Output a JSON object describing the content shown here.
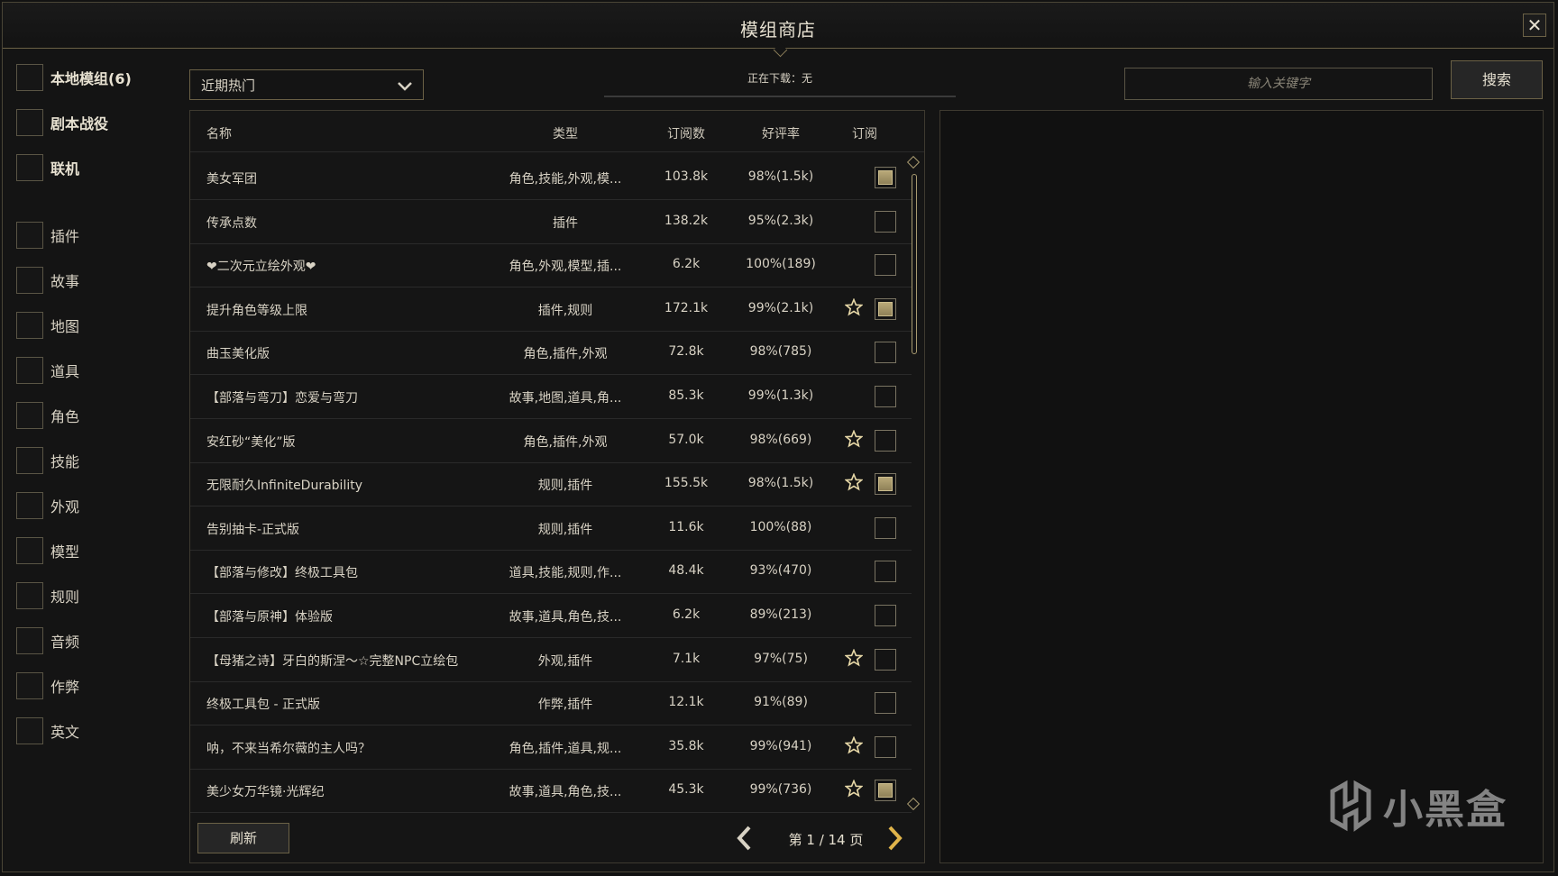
{
  "window": {
    "title": "模组商店",
    "close_glyph": "✕"
  },
  "sidebar": {
    "items": [
      {
        "label": "本地模组(6)",
        "bold": true
      },
      {
        "label": "剧本战役",
        "bold": true
      },
      {
        "label": "联机",
        "bold": true
      },
      {
        "label": "插件",
        "bold": false
      },
      {
        "label": "故事",
        "bold": false
      },
      {
        "label": "地图",
        "bold": false
      },
      {
        "label": "道具",
        "bold": false
      },
      {
        "label": "角色",
        "bold": false
      },
      {
        "label": "技能",
        "bold": false
      },
      {
        "label": "外观",
        "bold": false
      },
      {
        "label": "模型",
        "bold": false
      },
      {
        "label": "规则",
        "bold": false
      },
      {
        "label": "音频",
        "bold": false
      },
      {
        "label": "作弊",
        "bold": false
      },
      {
        "label": "英文",
        "bold": false
      }
    ]
  },
  "sort": {
    "selected": "近期热门"
  },
  "download": {
    "status": "正在下载：无"
  },
  "search": {
    "placeholder": "输入关键字",
    "button_label": "搜索"
  },
  "table": {
    "headers": {
      "name": "名称",
      "type": "类型",
      "subs": "订阅数",
      "rating": "好评率",
      "subscribe": "订阅"
    },
    "rows": [
      {
        "name": "美女军团",
        "type": "角色,技能,外观,模...",
        "subs": "103.8k",
        "rating": "98%(1.5k)",
        "starred": false,
        "subscribed": true
      },
      {
        "name": "传承点数",
        "type": "插件",
        "subs": "138.2k",
        "rating": "95%(2.3k)",
        "starred": false,
        "subscribed": false
      },
      {
        "name": "❤二次元立绘外观❤",
        "type": "角色,外观,模型,插...",
        "subs": "6.2k",
        "rating": "100%(189)",
        "starred": false,
        "subscribed": false
      },
      {
        "name": "提升角色等级上限",
        "type": "插件,规则",
        "subs": "172.1k",
        "rating": "99%(2.1k)",
        "starred": true,
        "subscribed": true
      },
      {
        "name": "曲玉美化版",
        "type": "角色,插件,外观",
        "subs": "72.8k",
        "rating": "98%(785)",
        "starred": false,
        "subscribed": false
      },
      {
        "name": "【部落与弯刀】恋爱与弯刀",
        "type": "故事,地图,道具,角...",
        "subs": "85.3k",
        "rating": "99%(1.3k)",
        "starred": false,
        "subscribed": false
      },
      {
        "name": "安红砂“美化”版",
        "type": "角色,插件,外观",
        "subs": "57.0k",
        "rating": "98%(669)",
        "starred": true,
        "subscribed": false
      },
      {
        "name": "无限耐久InfiniteDurability",
        "type": "规则,插件",
        "subs": "155.5k",
        "rating": "98%(1.5k)",
        "starred": true,
        "subscribed": true
      },
      {
        "name": "告别抽卡-正式版",
        "type": "规则,插件",
        "subs": "11.6k",
        "rating": "100%(88)",
        "starred": false,
        "subscribed": false
      },
      {
        "name": "【部落与修改】终极工具包",
        "type": "道具,技能,规则,作...",
        "subs": "48.4k",
        "rating": "93%(470)",
        "starred": false,
        "subscribed": false
      },
      {
        "name": "【部落与原神】体验版",
        "type": "故事,道具,角色,技...",
        "subs": "6.2k",
        "rating": "89%(213)",
        "starred": false,
        "subscribed": false
      },
      {
        "name": "【母猪之诗】牙白的斯涅～☆完整NPC立绘包",
        "type": "外观,插件",
        "subs": "7.1k",
        "rating": "97%(75)",
        "starred": true,
        "subscribed": false
      },
      {
        "name": "终极工具包 - 正式版",
        "type": "作弊,插件",
        "subs": "12.1k",
        "rating": "91%(89)",
        "starred": false,
        "subscribed": false
      },
      {
        "name": "呐，不来当希尔薇的主人吗？",
        "type": "角色,插件,道具,规...",
        "subs": "35.8k",
        "rating": "99%(941)",
        "starred": true,
        "subscribed": false
      },
      {
        "name": "美少女万华镜·光辉纪",
        "type": "故事,道具,角色,技...",
        "subs": "45.3k",
        "rating": "99%(736)",
        "starred": true,
        "subscribed": true
      }
    ]
  },
  "footer": {
    "refresh_label": "刷新",
    "page_info": "第 1 / 14 页"
  },
  "watermark": {
    "text": "小黑盒"
  },
  "colors": {
    "accent": "#b8a878",
    "border": "#6b6146",
    "background": "#141414"
  }
}
